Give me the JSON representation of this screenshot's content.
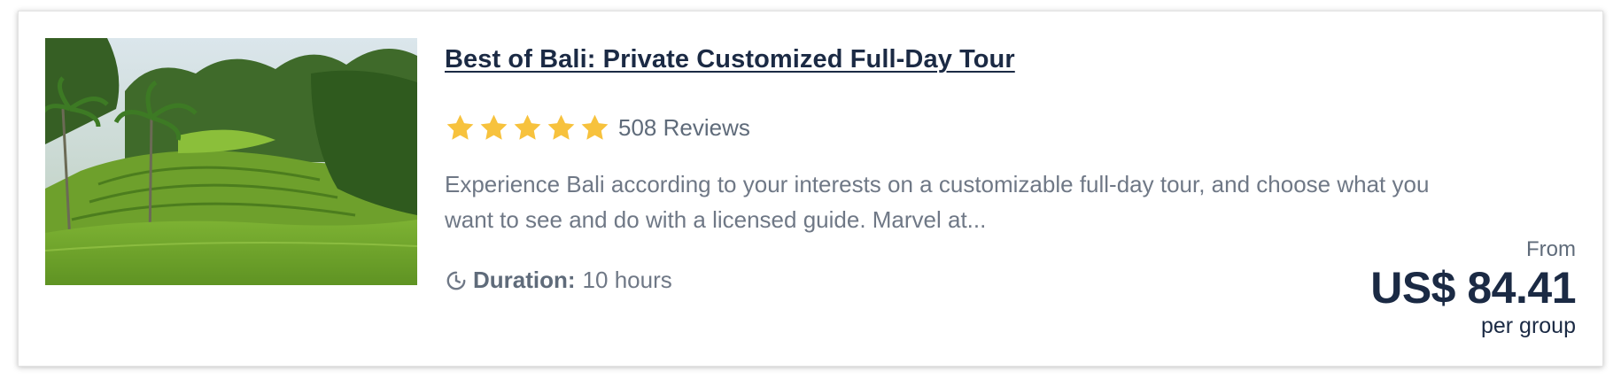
{
  "listing": {
    "title": "Best of Bali: Private Customized Full-Day Tour",
    "rating": {
      "stars": 5,
      "max_stars": 5,
      "reviews_text": "508 Reviews",
      "star_color": "#f7c23d",
      "star_icon": "star-icon"
    },
    "description": "Experience Bali according to your interests on a customizable full-day tour, and choose what you want to see and do with a licensed guide. Marvel at...",
    "duration": {
      "icon": "clock-icon",
      "label": "Duration:",
      "value": "10 hours"
    },
    "price": {
      "prefix": "From",
      "amount": "US$ 84.41",
      "unit": "per group"
    },
    "image": {
      "subject": "rice terraces with palm trees"
    }
  },
  "colors": {
    "title": "#1b2a44",
    "muted_text": "#6f7886",
    "star": "#f7c23d"
  }
}
